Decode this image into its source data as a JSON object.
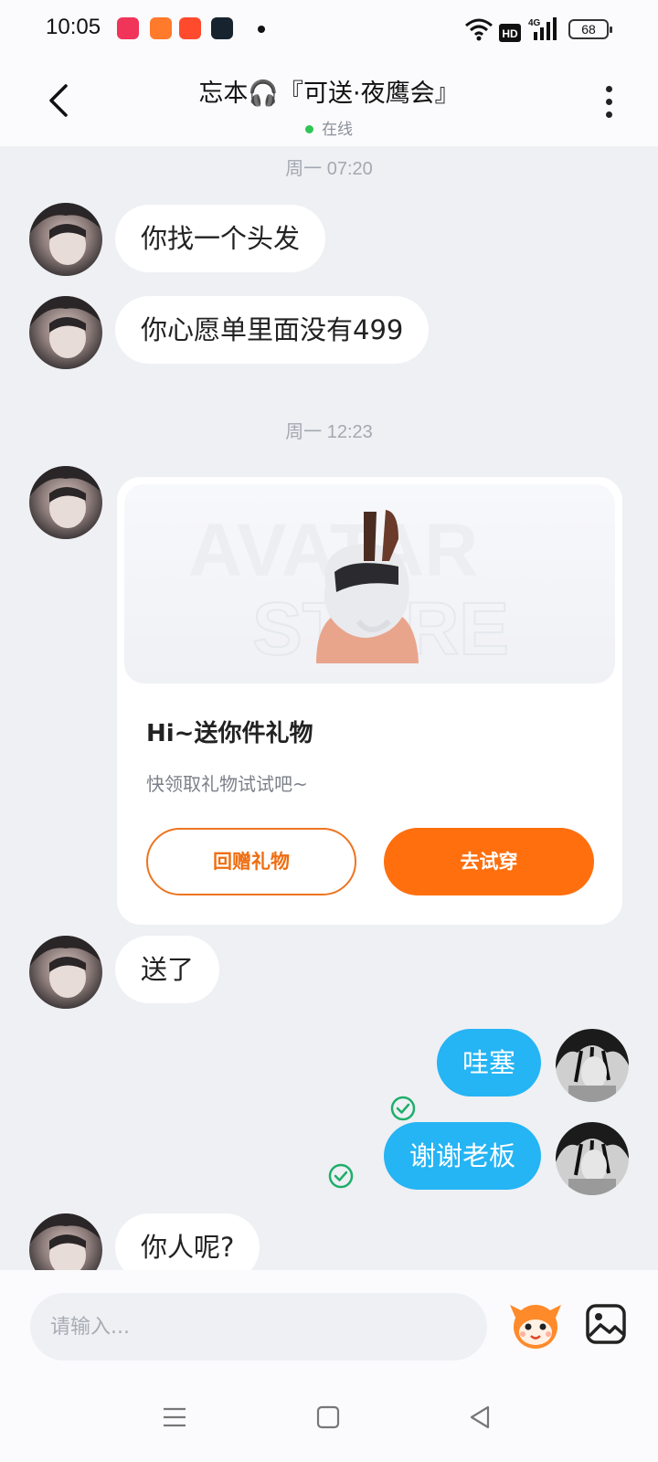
{
  "status_bar": {
    "time": "10:05",
    "hd_label": "HD",
    "network_label": "4G",
    "battery": "68",
    "app_icon_colors": [
      "#f0345a",
      "#ff7a2b",
      "#ff4a2e",
      "#17232e"
    ]
  },
  "header": {
    "title": "忘本🎧『可送·夜鹰会』",
    "status": "在线"
  },
  "messages": {
    "ts1": "周一 07:20",
    "m1": "你找一个头发",
    "m2": "你心愿单里面没有499",
    "ts2": "周一 12:23",
    "gift_card": {
      "watermark_top": "AVATAR",
      "watermark_bottom": "STORE",
      "title": "Hi~送你件礼物",
      "subtitle": "快领取礼物试试吧~",
      "return_button": "回赠礼物",
      "try_button": "去试穿"
    },
    "m3": "送了",
    "m4": "哇塞",
    "m5": "谢谢老板",
    "m6": "你人呢?"
  },
  "input": {
    "placeholder": "请输入..."
  },
  "colors": {
    "accent_orange": "#ff6f0e",
    "bubble_blue": "#25b4f4",
    "online_green": "#2fc655",
    "read_check": "#1fae6a"
  },
  "icons": [
    "back-arrow-icon",
    "headphones-icon",
    "more-vertical-icon",
    "check-circle-icon",
    "emoji-mascot-icon",
    "image-icon",
    "menu-icon",
    "home-square-icon",
    "back-triangle-icon"
  ]
}
